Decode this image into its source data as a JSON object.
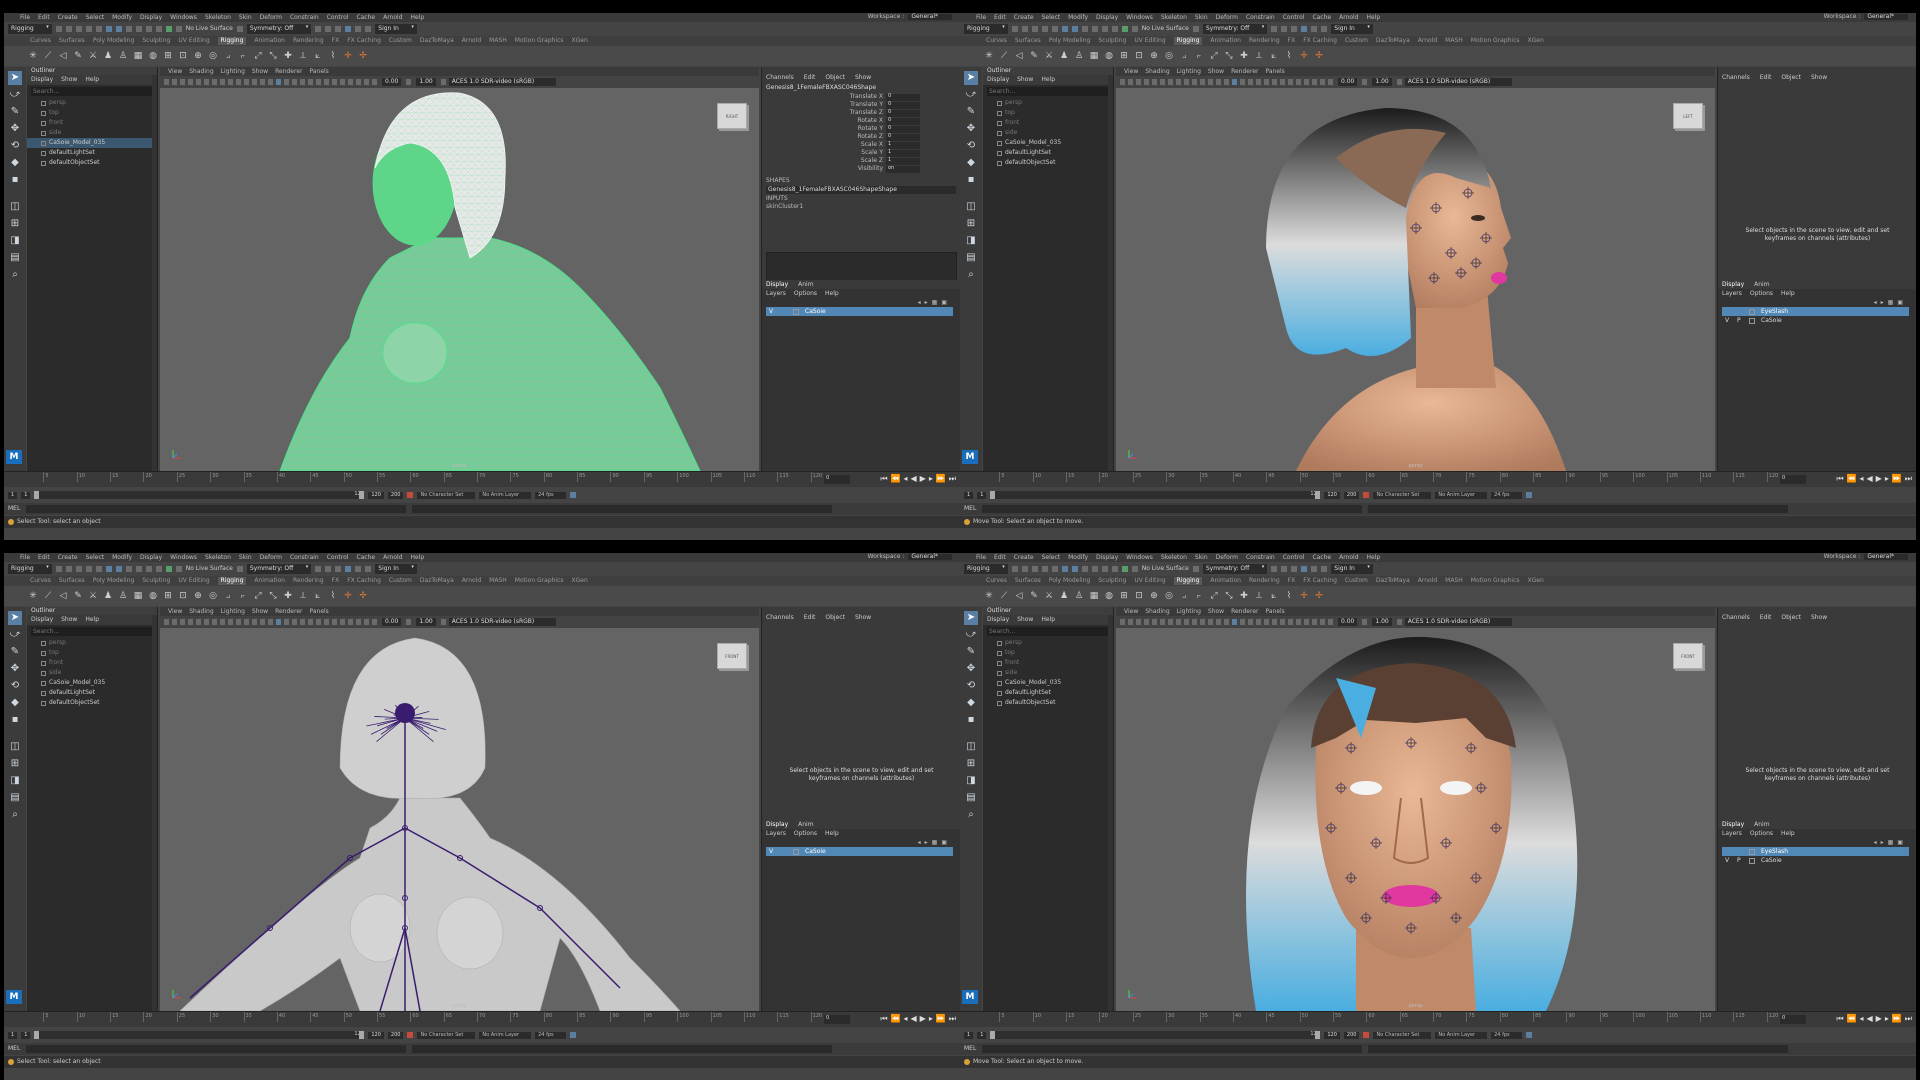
{
  "menu": [
    "File",
    "Edit",
    "Create",
    "Select",
    "Modify",
    "Display",
    "Windows",
    "Skeleton",
    "Skin",
    "Deform",
    "Constrain",
    "Control",
    "Cache",
    "Arnold",
    "Help"
  ],
  "workspace": {
    "label": "Workspace :",
    "value": "General*"
  },
  "status": {
    "mode": "Rigging",
    "surface": "No Live Surface",
    "symmetry": "Symmetry: Off",
    "signin": "Sign In"
  },
  "shelf_tabs": [
    "Curves",
    "Surfaces",
    "Poly Modeling",
    "Sculpting",
    "UV Editing",
    "Rigging",
    "Animation",
    "Rendering",
    "FX",
    "FX Caching",
    "Custom",
    "DazToMaya",
    "Arnold",
    "MASH",
    "Motion Graphics",
    "XGen"
  ],
  "shelf_active": "Rigging",
  "outliner": {
    "title": "Outliner",
    "menu": [
      "Display",
      "Show",
      "Help"
    ],
    "search": "Search...",
    "items": [
      {
        "label": "persp",
        "dim": true
      },
      {
        "label": "top",
        "dim": true
      },
      {
        "label": "front",
        "dim": true
      },
      {
        "label": "side",
        "dim": true
      },
      {
        "label": "CaSoie_Model_035",
        "dim": false
      },
      {
        "label": "defaultLightSet",
        "dim": false
      },
      {
        "label": "defaultObjectSet",
        "dim": false
      }
    ]
  },
  "viewport": {
    "menu": [
      "View",
      "Shading",
      "Lighting",
      "Show",
      "Renderer",
      "Panels"
    ],
    "num1": "0.00",
    "num2": "1.00",
    "colorspace": "ACES 1.0 SDR-video (sRGB)"
  },
  "channels": {
    "menu": [
      "Channels",
      "Edit",
      "Object",
      "Show"
    ],
    "node": "Genesis8_1FemaleFBXASC046Shape",
    "attrs": [
      {
        "name": "Translate X",
        "value": "0"
      },
      {
        "name": "Translate Y",
        "value": "0"
      },
      {
        "name": "Translate Z",
        "value": "0"
      },
      {
        "name": "Rotate X",
        "value": "0"
      },
      {
        "name": "Rotate Y",
        "value": "0"
      },
      {
        "name": "Rotate Z",
        "value": "0"
      },
      {
        "name": "Scale X",
        "value": "1"
      },
      {
        "name": "Scale Y",
        "value": "1"
      },
      {
        "name": "Scale Z",
        "value": "1"
      },
      {
        "name": "Visibility",
        "value": "on"
      }
    ],
    "shapes_label": "SHAPES",
    "shape_value": "Genesis8_1FemaleFBXASC046ShapeShape",
    "inputs_label": "INPUTS",
    "input_value": "skinCluster1",
    "empty_text": "Select objects in the scene to view, edit and set keyframes on channels (attributes)"
  },
  "layers": {
    "tabs": [
      "Display",
      "Anim"
    ],
    "menu": [
      "Layers",
      "Options",
      "Help"
    ],
    "rows_a": [
      {
        "vis": "V",
        "type": "",
        "name": "CaSoie",
        "sel": true
      }
    ],
    "rows_b": [
      {
        "vis": "",
        "type": "",
        "name": "EyeSlash",
        "sel": true
      },
      {
        "vis": "V",
        "type": "P",
        "name": "CaSoie",
        "sel": false
      }
    ]
  },
  "timeline": {
    "ticks": [
      "5",
      "10",
      "15",
      "20",
      "25",
      "30",
      "35",
      "40",
      "45",
      "50",
      "55",
      "60",
      "65",
      "70",
      "75",
      "80",
      "85",
      "90",
      "95",
      "100",
      "105",
      "110",
      "115",
      "120"
    ],
    "current": "0"
  },
  "range": {
    "start": "1",
    "inner_start": "1",
    "inner_end": "120",
    "end_inner": "120",
    "end": "200",
    "charset": "No Character Set",
    "animlayer": "No Anim Layer",
    "fps": "24 fps"
  },
  "cmdline": {
    "label": "MEL"
  },
  "help_select": "Select Tool: select an object",
  "help_move": "Move Tool: Select an object to move.",
  "cube_labels": {
    "tl": "RIGHT",
    "tr": "LEFT",
    "bl": "FRONT",
    "br": "FRONT"
  },
  "cam": "persp",
  "colors": {
    "accent": "#5288b5",
    "wireframe": "#4fe08a",
    "joint": "#3a1c6e",
    "hair_blue": "#4aaee0",
    "lips": "#e0389e"
  }
}
